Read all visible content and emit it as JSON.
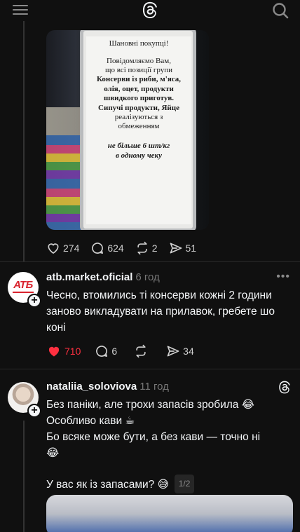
{
  "header": {
    "menu_icon": "menu-icon",
    "logo": "threads-logo",
    "search_icon": "search-icon"
  },
  "post_image": {
    "sign_lines": [
      "Шановні покупці!",
      "Повідомляємо Вам,",
      "що всі позиції групи",
      "Консерви із риби, м'яса,",
      "олія, оцет, продукти",
      "швидкого приготув.",
      "Сипучі продукти, Яйце",
      "реалізуються з",
      "обмеженням",
      "не більше 6 шт/кг",
      "в одному чеку"
    ]
  },
  "post_actions": {
    "likes": "274",
    "comments": "624",
    "reposts": "2",
    "shares": "51"
  },
  "reply1": {
    "username": "atb.market.oficial",
    "time": "6 год",
    "avatar_text": "АТБ",
    "text": "Чесно, втомились ті консерви кожні 2 години заново викладувати на прилавок, гребете шо коні",
    "likes": "710",
    "comments": "6",
    "shares": "34",
    "liked": true,
    "like_color": "#ff3040"
  },
  "reply2": {
    "username": "nataliia_soloviova",
    "time": "11 год",
    "line1": "Без паніки, але трохи запасів зробила 😂",
    "line2": "Особливо кави ☕",
    "line3": "Бо всяке може бути, а без кави — точно ні",
    "line4": "😂",
    "line5": "У вас як із запасами? 😅",
    "pager": "1/2"
  }
}
